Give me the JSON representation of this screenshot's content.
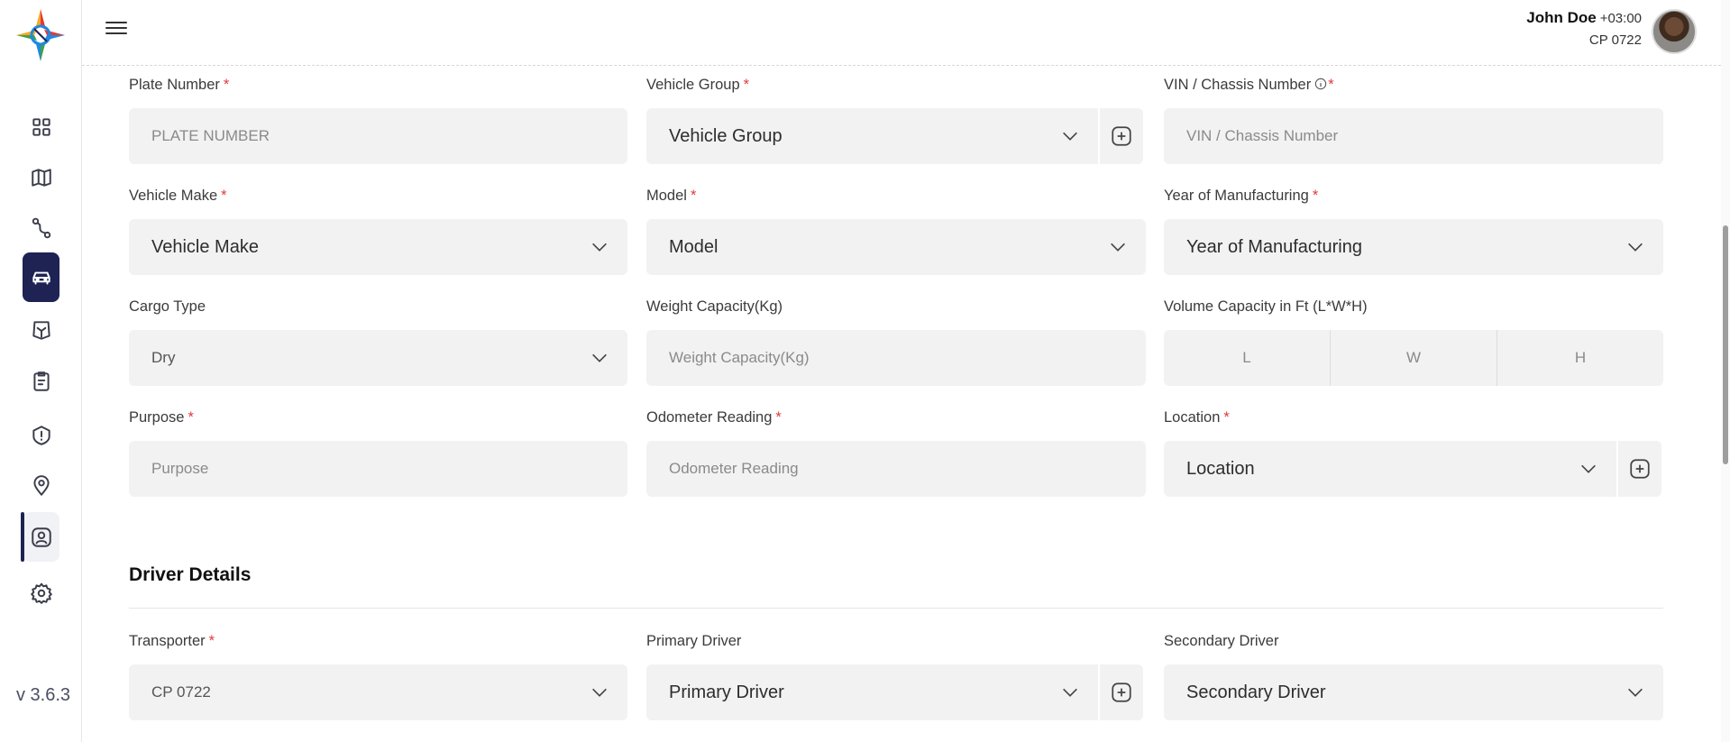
{
  "app": {
    "version": "v 3.6.3"
  },
  "user": {
    "name": "John Doe",
    "timezone": "+03:00",
    "code": "CP 0722"
  },
  "sidebar": {
    "items": [
      "dashboard",
      "map",
      "routes",
      "vehicles",
      "tracking",
      "tasks",
      "alerts",
      "locations",
      "users",
      "settings"
    ]
  },
  "form": {
    "plate_number": {
      "label": "Plate Number",
      "placeholder": "PLATE NUMBER"
    },
    "vehicle_group": {
      "label": "Vehicle Group",
      "value": "Vehicle Group"
    },
    "vin": {
      "label": "VIN / Chassis Number",
      "placeholder": "VIN / Chassis Number"
    },
    "vehicle_make": {
      "label": "Vehicle Make",
      "value": "Vehicle Make"
    },
    "model": {
      "label": "Model",
      "value": "Model"
    },
    "year": {
      "label": "Year of Manufacturing",
      "value": "Year of Manufacturing"
    },
    "cargo_type": {
      "label": "Cargo Type",
      "value": "Dry"
    },
    "weight": {
      "label": "Weight Capacity(Kg)",
      "placeholder": "Weight Capacity(Kg)"
    },
    "volume": {
      "label": "Volume Capacity in Ft (L*W*H)",
      "l": "L",
      "w": "W",
      "h": "H"
    },
    "purpose": {
      "label": "Purpose",
      "placeholder": "Purpose"
    },
    "odometer": {
      "label": "Odometer Reading",
      "placeholder": "Odometer Reading"
    },
    "location": {
      "label": "Location",
      "value": "Location"
    }
  },
  "driver_section": {
    "title": "Driver Details",
    "transporter": {
      "label": "Transporter",
      "value": "CP 0722"
    },
    "primary_driver": {
      "label": "Primary Driver",
      "value": "Primary Driver"
    },
    "secondary_driver": {
      "label": "Secondary Driver",
      "value": "Secondary Driver"
    }
  },
  "required_mark": "*",
  "colors": {
    "accent": "#1e2354",
    "required": "#e03a3a",
    "field_bg": "#f2f2f2"
  }
}
